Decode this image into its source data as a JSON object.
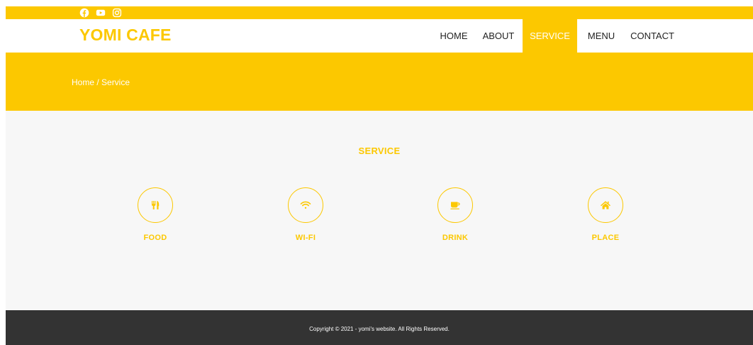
{
  "topbar": {
    "social_icons": [
      "facebook-icon",
      "youtube-icon",
      "instagram-icon"
    ],
    "background_color": "#fcc800"
  },
  "navbar": {
    "brand": "YOMI CAFE",
    "items": [
      {
        "label": "HOME",
        "active": false
      },
      {
        "label": "ABOUT",
        "active": false
      },
      {
        "label": "SERVICE",
        "active": true
      },
      {
        "label": "MENU",
        "active": false
      },
      {
        "label": "CONTACT",
        "active": false
      }
    ]
  },
  "hero": {
    "breadcrumb": "Home / Service"
  },
  "services": {
    "title": "SERVICE",
    "items": [
      {
        "label": "FOOD",
        "icon": "utensils-icon"
      },
      {
        "label": "WI-FI",
        "icon": "wifi-icon"
      },
      {
        "label": "DRINK",
        "icon": "coffee-icon"
      },
      {
        "label": "PLACE",
        "icon": "home-icon"
      }
    ]
  },
  "footer": {
    "copyright": "Copyright © 2021 - yomi's website. All Rights Reserved."
  },
  "colors": {
    "accent": "#fcc800",
    "page_background": "#f7f7f7",
    "footer_background": "#333333"
  }
}
